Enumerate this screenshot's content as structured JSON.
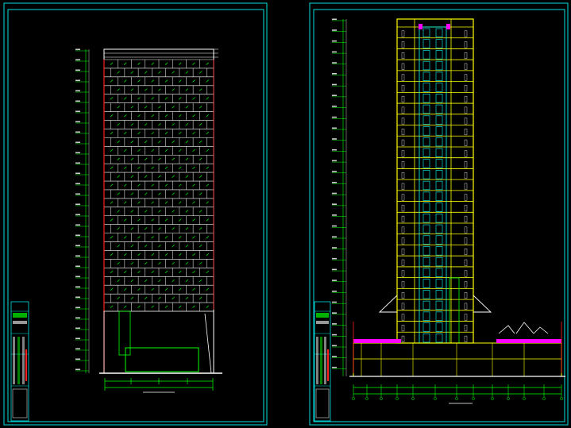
{
  "drawing": {
    "sheets": [
      {
        "id": "elevation",
        "title": "",
        "view": "front-elevation"
      },
      {
        "id": "section",
        "title": "",
        "view": "building-section"
      }
    ],
    "colors": {
      "background": "#000000",
      "frame": "#00e0e0",
      "facade": "#ffffff",
      "glazing": "#00ff00",
      "accent_red": "#ff2020",
      "floor_lines": "#ffff00",
      "section_fill": "#00ffff",
      "roof_accent": "#ff00ff",
      "dim_lines": "#00ff00"
    },
    "elevation": {
      "floors": 29,
      "podium_floors": 3
    },
    "section": {
      "floors": 29,
      "podium_floors": 3
    }
  }
}
